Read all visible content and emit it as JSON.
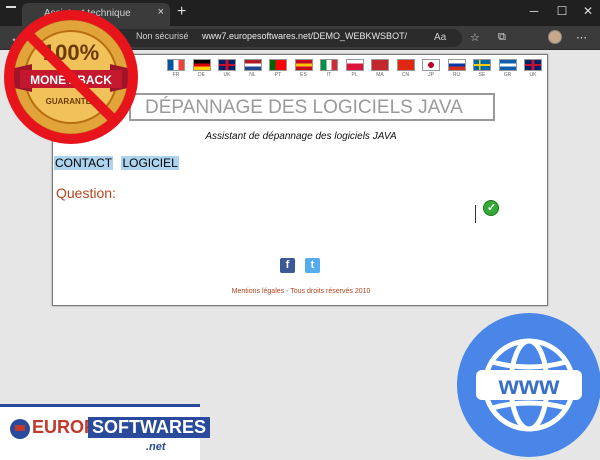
{
  "browser": {
    "tab_title": "Assistant technique",
    "tab_close": "×",
    "new_tab": "+",
    "security": "Non sécurisé",
    "url": "www7.europesoftwares.net/DEMO_WEBKWSBOT/",
    "nav_back": "←",
    "nav_refresh": "↻",
    "win_minimize": "─",
    "win_maximize": "☐",
    "win_close": "✕",
    "icon_reader": "Aa",
    "icon_favorite": "☆",
    "icon_collections": "⧉",
    "icon_menu": "⋯"
  },
  "flags": [
    {
      "code": "FR",
      "colors": [
        "#0055a4",
        "#ffffff",
        "#ef4135"
      ],
      "dir": "v"
    },
    {
      "code": "DE",
      "colors": [
        "#000000",
        "#dd0000",
        "#ffce00"
      ],
      "dir": "h"
    },
    {
      "code": "UK",
      "colors": [
        "#012169",
        "#ffffff",
        "#c8102e"
      ],
      "dir": "uk"
    },
    {
      "code": "NL",
      "colors": [
        "#ae1c28",
        "#ffffff",
        "#21468b"
      ],
      "dir": "h"
    },
    {
      "code": "PT",
      "colors": [
        "#006600",
        "#ff0000",
        "#ff0000"
      ],
      "dir": "v"
    },
    {
      "code": "ES",
      "colors": [
        "#c60b1e",
        "#ffc400",
        "#c60b1e"
      ],
      "dir": "h"
    },
    {
      "code": "IT",
      "colors": [
        "#009246",
        "#ffffff",
        "#ce2b37"
      ],
      "dir": "v"
    },
    {
      "code": "PL",
      "colors": [
        "#ffffff",
        "#dc143c",
        "#dc143c"
      ],
      "dir": "h"
    },
    {
      "code": "MA",
      "colors": [
        "#c1272d",
        "#c1272d",
        "#c1272d"
      ],
      "dir": "h"
    },
    {
      "code": "CN",
      "colors": [
        "#de2910",
        "#de2910",
        "#de2910"
      ],
      "dir": "h"
    },
    {
      "code": "JP",
      "colors": [
        "#ffffff",
        "#ffffff",
        "#ffffff"
      ],
      "dir": "jp"
    },
    {
      "code": "RU",
      "colors": [
        "#ffffff",
        "#0039a6",
        "#d52b1e"
      ],
      "dir": "h"
    },
    {
      "code": "SE",
      "colors": [
        "#006aa7",
        "#006aa7",
        "#006aa7"
      ],
      "dir": "se"
    },
    {
      "code": "GR",
      "colors": [
        "#0d5eaf",
        "#ffffff",
        "#0d5eaf"
      ],
      "dir": "h"
    },
    {
      "code": "UK",
      "colors": [
        "#012169",
        "#ffffff",
        "#c8102e"
      ],
      "dir": "uk"
    }
  ],
  "page": {
    "title": "DÉPANNAGE DES LOGICIELS JAVA",
    "subtitle": "Assistant de dépannage des logiciels JAVA",
    "menu": [
      "CONTACT",
      "LOGICIEL"
    ],
    "question_label": "Question:",
    "footer": "Mentions légales - Tous droits réservés 2010",
    "facebook": "f",
    "twitter": "t",
    "submit_check": "✓"
  },
  "badge": {
    "top": "100%",
    "middle": "MONEY BACK",
    "bottom": "GUARANTEE"
  },
  "www_badge": {
    "text": "www",
    "color": "#4a86e8"
  },
  "logo": {
    "part1": "EUROPE",
    "part2": "SOFTWARES",
    "part3": ".net"
  }
}
